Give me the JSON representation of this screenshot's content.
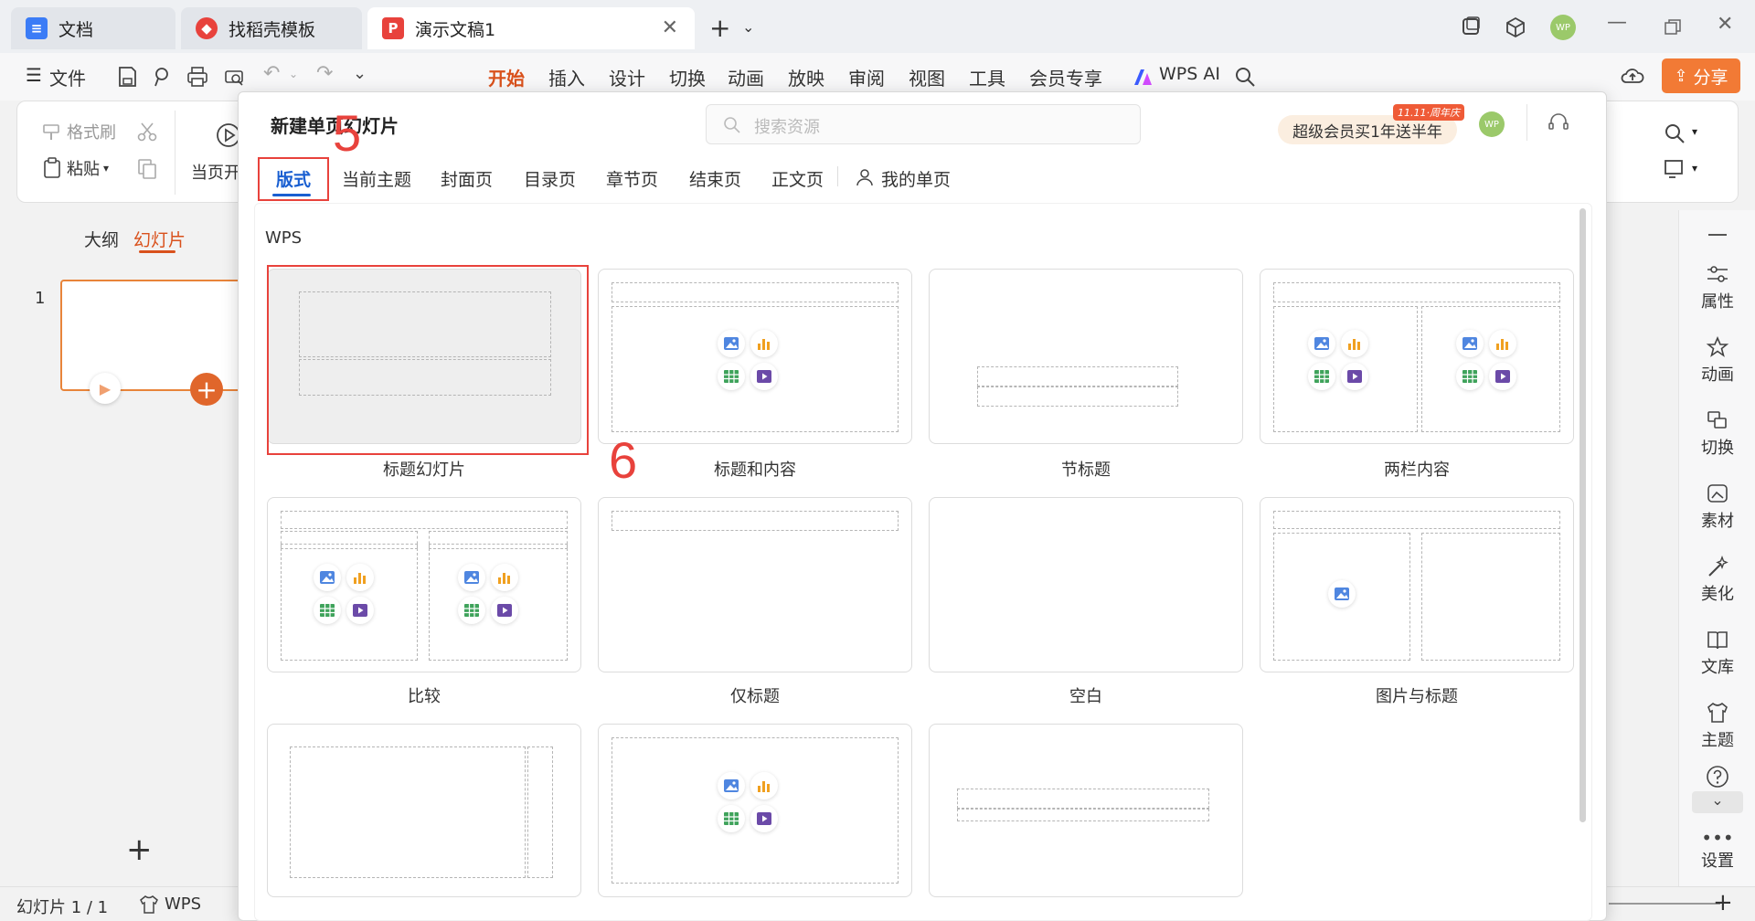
{
  "titlebar": {
    "tabs": [
      {
        "label": "文档",
        "icon": "docs-icon",
        "color": "#3b7cf6"
      },
      {
        "label": "找稻壳模板",
        "icon": "docer-icon",
        "color": "#e8423c"
      },
      {
        "label": "演示文稿1",
        "icon": "presentation-icon",
        "color": "#e8423c"
      }
    ],
    "avatar": "WP"
  },
  "menubar": {
    "file": "文件",
    "items": [
      "开始",
      "插入",
      "设计",
      "切换",
      "动画",
      "放映",
      "审阅",
      "视图",
      "工具",
      "会员专享"
    ],
    "active": "开始",
    "ai": "WPS AI",
    "share": "分享",
    "accent": "#d9511c"
  },
  "ribbon": {
    "format_painter": "格式刷",
    "paste": "粘贴",
    "current_start": "当页开"
  },
  "leftpane": {
    "tabs": [
      "大纲",
      "幻灯片"
    ],
    "active": "幻灯片",
    "slide_number": "1",
    "add": "+"
  },
  "rightbar": {
    "items": [
      "属性",
      "动画",
      "切换",
      "素材",
      "美化",
      "文库",
      "主题",
      "设置"
    ]
  },
  "statusbar": {
    "slide_info": "幻灯片 1 / 1",
    "theme": "WPS"
  },
  "dialog": {
    "title": "新建单页幻灯片",
    "search_placeholder": "搜索资源",
    "promo": "超级会员买1年送半年",
    "promo_badge": "11.11·周年庆",
    "avatar": "WP",
    "tabs": [
      "版式",
      "当前主题",
      "封面页",
      "目录页",
      "章节页",
      "结束页",
      "正文页",
      "我的单页"
    ],
    "active_tab": "版式",
    "section": "WPS",
    "layouts": [
      "标题幻灯片",
      "标题和内容",
      "节标题",
      "两栏内容",
      "比较",
      "仅标题",
      "空白",
      "图片与标题"
    ]
  },
  "annotations": [
    "5",
    "6"
  ]
}
